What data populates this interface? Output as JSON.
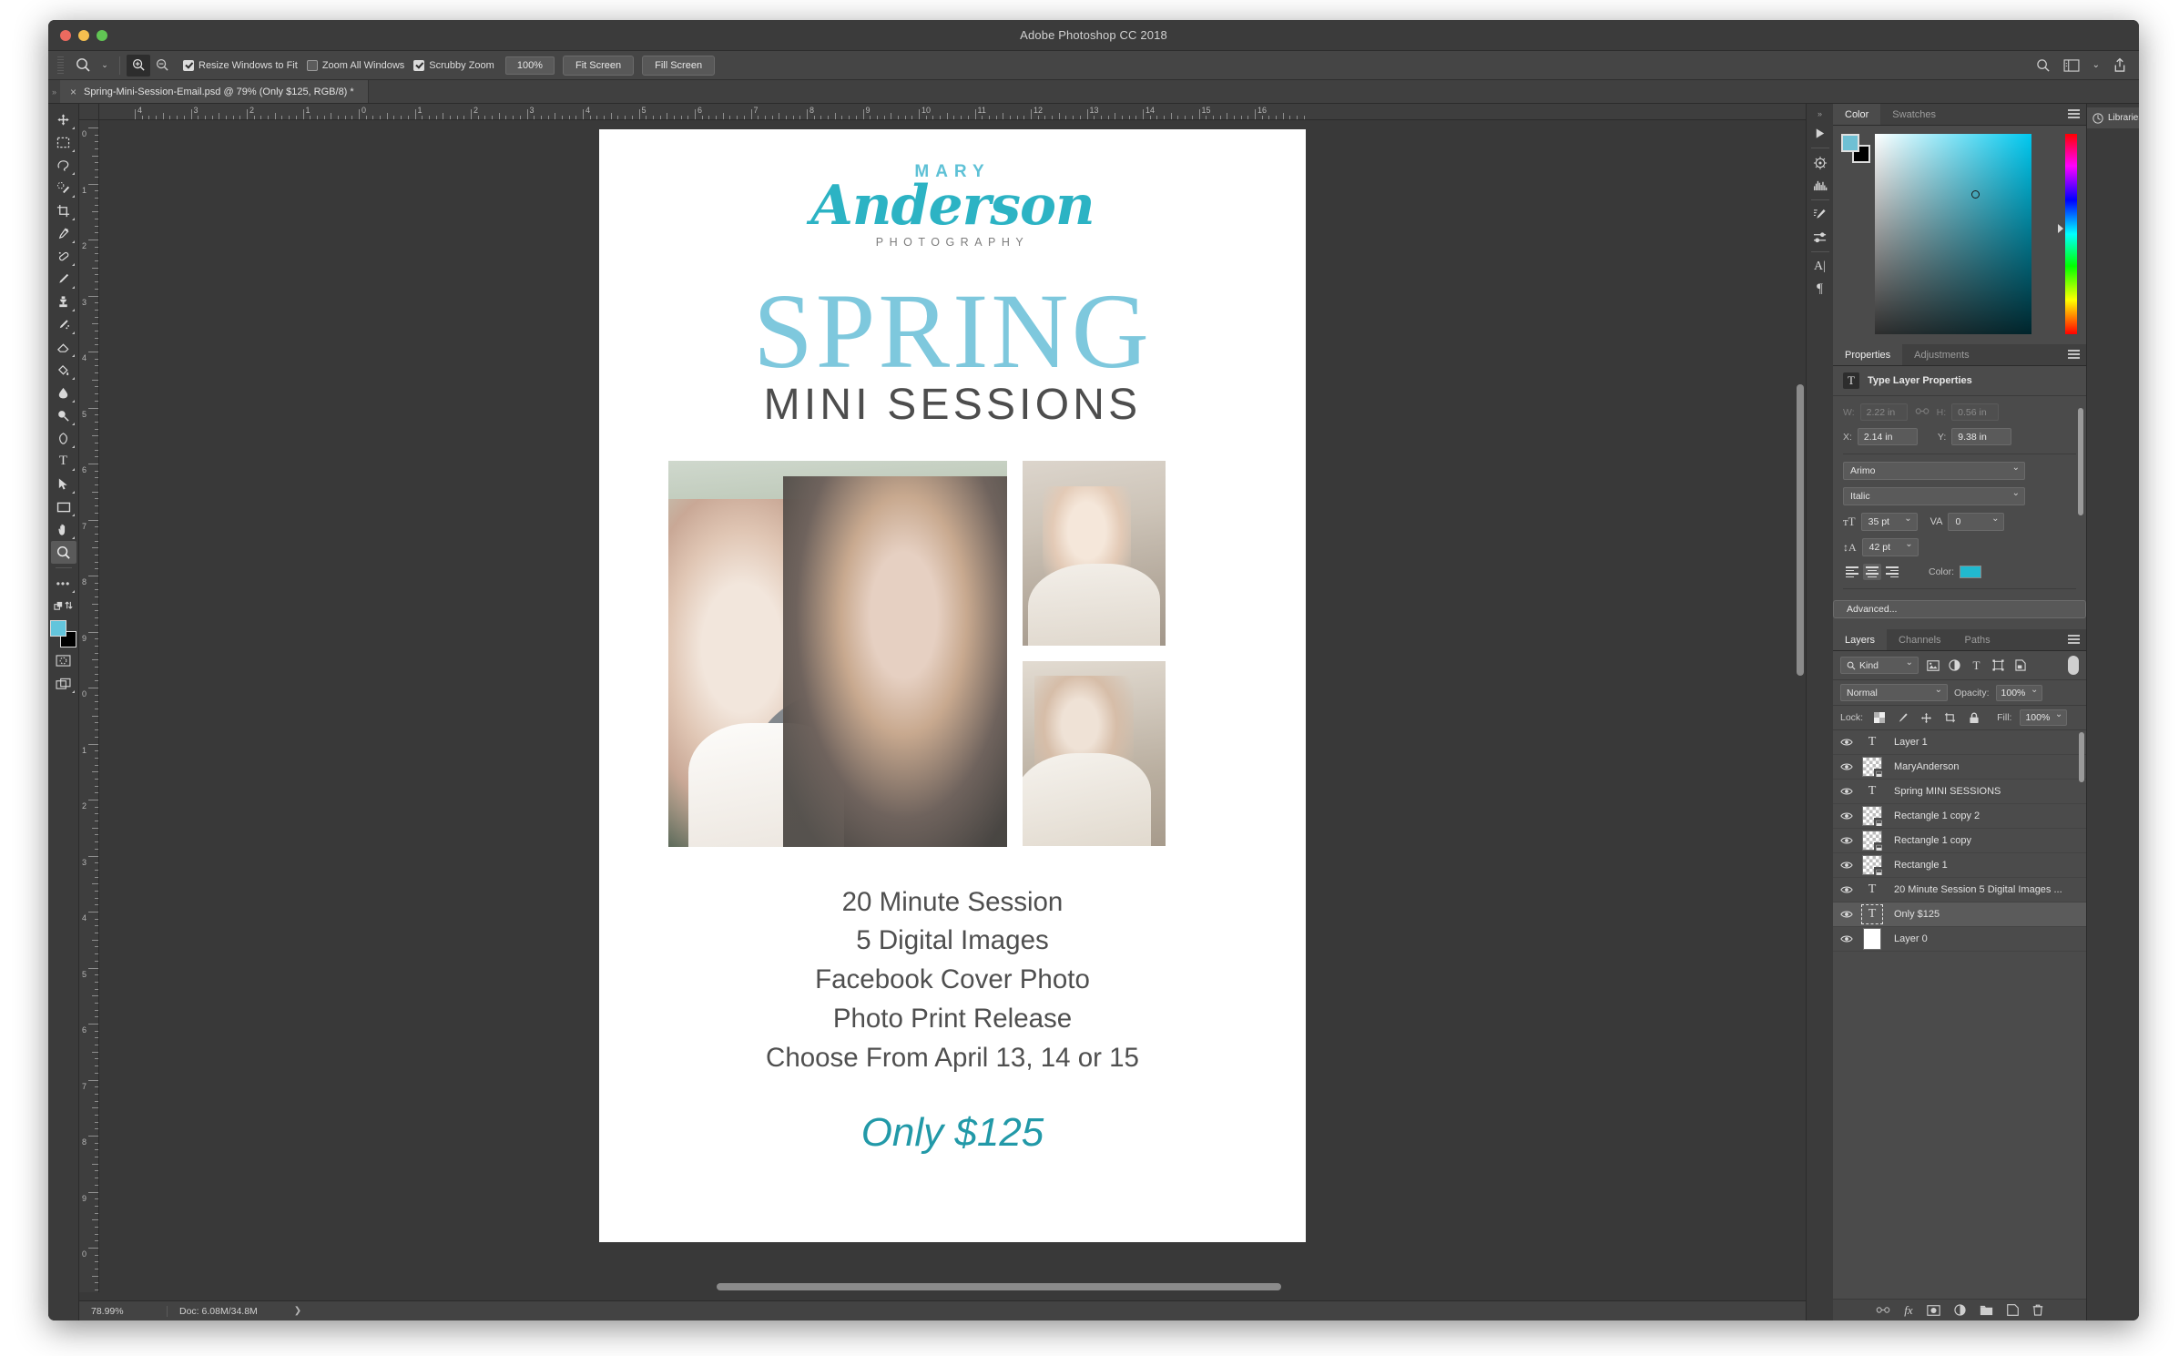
{
  "window": {
    "title": "Adobe Photoshop CC 2018",
    "traffic": [
      "close",
      "minimize",
      "maximize"
    ]
  },
  "options_bar": {
    "tool_icon": "zoom-icon",
    "zoom_in_label": "zoom-in-icon",
    "zoom_out_label": "zoom-out-icon",
    "checkboxes": [
      {
        "label": "Resize Windows to Fit",
        "checked": true
      },
      {
        "label": "Zoom All Windows",
        "checked": false
      },
      {
        "label": "Scrubby Zoom",
        "checked": true
      }
    ],
    "zoom_value": "100%",
    "buttons": [
      "Fit Screen",
      "Fill Screen"
    ],
    "right_icons": [
      "search-icon",
      "workspace-icon",
      "chevron-down-icon",
      "share-icon"
    ]
  },
  "document_tab": {
    "close": "×",
    "title": "Spring-Mini-Session-Email.psd @ 79% (Only $125, RGB/8) *"
  },
  "toolbar": {
    "tools": [
      {
        "name": "move-tool",
        "glyph": "✥",
        "triangle": true,
        "selected": false
      },
      {
        "name": "marquee-tool",
        "glyph": "▭",
        "triangle": true,
        "selected": false
      },
      {
        "name": "lasso-tool",
        "glyph": "✧",
        "triangle": true,
        "selected": false
      },
      {
        "name": "quick-selection-tool",
        "glyph": "✎",
        "triangle": true,
        "selected": false
      },
      {
        "name": "crop-tool",
        "glyph": "⌗",
        "triangle": true,
        "selected": false
      },
      {
        "name": "eyedropper-tool",
        "glyph": "⚲",
        "triangle": true,
        "selected": false
      },
      {
        "name": "healing-brush-tool",
        "glyph": "✚",
        "triangle": true,
        "selected": false
      },
      {
        "name": "brush-tool",
        "glyph": "✐",
        "triangle": true,
        "selected": false
      },
      {
        "name": "clone-stamp-tool",
        "glyph": "⚱",
        "triangle": true,
        "selected": false
      },
      {
        "name": "history-brush-tool",
        "glyph": "✧",
        "triangle": true,
        "selected": false
      },
      {
        "name": "eraser-tool",
        "glyph": "◰",
        "triangle": true,
        "selected": false
      },
      {
        "name": "paint-bucket-tool",
        "glyph": "◣",
        "triangle": true,
        "selected": false
      },
      {
        "name": "blur-tool",
        "glyph": "💧",
        "triangle": true,
        "selected": false
      },
      {
        "name": "dodge-tool",
        "glyph": "◯",
        "triangle": true,
        "selected": false
      },
      {
        "name": "pen-tool",
        "glyph": "✒",
        "triangle": true,
        "selected": false
      },
      {
        "name": "type-tool",
        "glyph": "T",
        "triangle": true,
        "selected": false
      },
      {
        "name": "path-selection-tool",
        "glyph": "➤",
        "triangle": true,
        "selected": false
      },
      {
        "name": "rectangle-tool",
        "glyph": "▢",
        "triangle": true,
        "selected": false
      },
      {
        "name": "hand-tool",
        "glyph": "✋",
        "triangle": true,
        "selected": false
      },
      {
        "name": "zoom-tool",
        "glyph": "🔍",
        "triangle": false,
        "selected": true
      },
      {
        "name": "edit-toolbar-tool",
        "glyph": "•••",
        "triangle": true,
        "selected": false
      }
    ],
    "foreground_color": "#63c5dc",
    "background_color": "#000000",
    "quick_mask": "quick-mask-icon",
    "screen_mode": "screen-mode-icon"
  },
  "rulers": {
    "unit": "inches",
    "horizontal_labels": [
      "4",
      "3",
      "2",
      "1",
      "0",
      "1",
      "2",
      "3",
      "4",
      "5",
      "6",
      "7",
      "8",
      "9",
      "10"
    ],
    "vertical_labels": [
      "0",
      "1",
      "2",
      "3",
      "4",
      "5",
      "6",
      "7",
      "8",
      "9",
      "0"
    ]
  },
  "flyer": {
    "logo_top": "MARY",
    "logo_script": "Anderson",
    "logo_bottom": "PHOTOGRAPHY",
    "headline": "SPRING",
    "subheadline": "MINI SESSIONS",
    "body_lines": [
      "20 Minute Session",
      "5 Digital Images",
      "Facebook Cover Photo",
      "Photo Print Release",
      "Choose From April 13, 14 or 15"
    ],
    "price": "Only $125",
    "accent_color": "#2cb3c4",
    "headline_color": "#7ec8dd",
    "body_color": "#4f4f4f"
  },
  "status_bar": {
    "zoom": "78.99%",
    "doc": "Doc: 6.08M/34.8M",
    "arrow": "❯"
  },
  "dock_rail": {
    "icons": [
      "timeline-play-icon",
      "color-wheel-icon",
      "histogram-icon",
      "brush-settings-icon",
      "adjustments-slider-icon",
      "character-icon",
      "paragraph-icon"
    ]
  },
  "color_panel": {
    "tabs": [
      {
        "label": "Color",
        "active": true
      },
      {
        "label": "Swatches",
        "active": false
      }
    ],
    "foreground": "#6fc0d4",
    "background": "#000000",
    "menu": "panel-menu-icon"
  },
  "properties_panel": {
    "tabs": [
      {
        "label": "Properties",
        "active": true
      },
      {
        "label": "Adjustments",
        "active": false
      }
    ],
    "header": "Type Layer Properties",
    "header_icon": "T",
    "w_label": "W:",
    "w_value": "2.22 in",
    "link_icon": "link-icon",
    "h_label": "H:",
    "h_value": "0.56 in",
    "x_label": "X:",
    "x_value": "2.14 in",
    "y_label": "Y:",
    "y_value": "9.38 in",
    "font_family": "Arimo",
    "font_style": "Italic",
    "font_size": "35 pt",
    "tracking": "0",
    "leading": "42 pt",
    "align": [
      "left",
      "center",
      "right"
    ],
    "align_active": "center",
    "color_label": "Color:",
    "color_value": "#21b9cf",
    "advanced_label": "Advanced..."
  },
  "layers_panel": {
    "tabs": [
      {
        "label": "Layers",
        "active": true
      },
      {
        "label": "Channels",
        "active": false
      },
      {
        "label": "Paths",
        "active": false
      }
    ],
    "filter_label": "Kind",
    "filter_icons": [
      "pixel-filter-icon",
      "adjustment-filter-icon",
      "type-filter-icon",
      "shape-filter-icon",
      "smartobject-filter-icon"
    ],
    "filter_toggle": "filter-enable-toggle",
    "blend_mode": "Normal",
    "opacity_label": "Opacity:",
    "opacity_value": "100%",
    "lock_label": "Lock:",
    "lock_icons": [
      "lock-transparency-icon",
      "lock-image-icon",
      "lock-position-icon",
      "lock-artboard-icon",
      "lock-all-icon"
    ],
    "fill_label": "Fill:",
    "fill_value": "100%",
    "layers": [
      {
        "name": "Layer 1",
        "thumb": "type",
        "visible": true,
        "selected": false
      },
      {
        "name": "MaryAnderson",
        "thumb": "smart",
        "visible": true,
        "selected": false
      },
      {
        "name": "Spring MINI SESSIONS",
        "thumb": "type",
        "visible": true,
        "selected": false
      },
      {
        "name": "Rectangle 1 copy 2",
        "thumb": "smart",
        "visible": true,
        "selected": false
      },
      {
        "name": "Rectangle 1 copy",
        "thumb": "smart",
        "visible": true,
        "selected": false
      },
      {
        "name": "Rectangle 1",
        "thumb": "smart",
        "visible": true,
        "selected": false
      },
      {
        "name": "20 Minute Session 5 Digital Images ...",
        "thumb": "type",
        "visible": true,
        "selected": false
      },
      {
        "name": "Only $125",
        "thumb": "type-boxed",
        "visible": true,
        "selected": true
      },
      {
        "name": "Layer 0",
        "thumb": "white",
        "visible": true,
        "selected": false
      }
    ],
    "footer_icons": [
      "link-layers-icon",
      "layer-style-fx-icon",
      "layer-mask-icon",
      "adjustment-layer-icon",
      "new-group-icon",
      "new-layer-icon",
      "delete-layer-icon"
    ]
  },
  "libraries_rail": {
    "label": "Libraries",
    "icon": "libraries-icon"
  }
}
